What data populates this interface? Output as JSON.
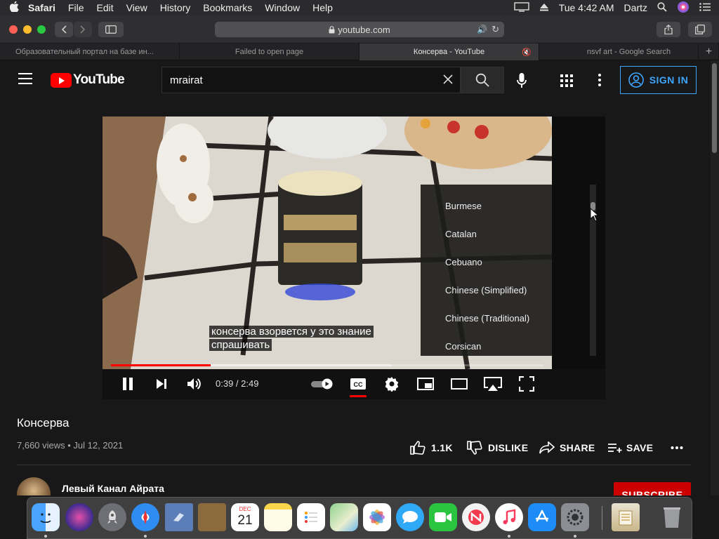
{
  "menubar": {
    "apple": "",
    "app": "Safari",
    "items": [
      "File",
      "Edit",
      "View",
      "History",
      "Bookmarks",
      "Window",
      "Help"
    ],
    "clock": "Tue 4:42 AM",
    "user": "Dartz"
  },
  "toolbar": {
    "url": "youtube.com"
  },
  "tabs": [
    {
      "title": "Образовательный портал на базе ин..."
    },
    {
      "title": "Failed to open page"
    },
    {
      "title": "Консерва - YouTube",
      "mute": "🔇"
    },
    {
      "title": "nsvf art - Google Search"
    }
  ],
  "youtube": {
    "logo_text": "YouTube",
    "search_value": "mrairat",
    "sign_in": "SIGN IN"
  },
  "player": {
    "caption_line1": "консерва взорвется у это знание",
    "caption_line2": "спрашивать",
    "time": "0:39 / 2:49",
    "progress_played": 0.23,
    "progress_loaded": 0.65,
    "languages": [
      "Burmese",
      "Catalan",
      "Cebuano",
      "Chinese (Simplified)",
      "Chinese (Traditional)",
      "Corsican"
    ]
  },
  "video": {
    "title": "Консерва",
    "views_date": "7,660 views • Jul 12, 2021",
    "like_count": "1.1K",
    "dislike": "DISLIKE",
    "share": "SHARE",
    "save": "SAVE"
  },
  "channel": {
    "name": "Левый Канал Айрата",
    "subscribe": "SUBSCRIBE"
  },
  "dock": {
    "calendar_month": "DEC",
    "calendar_day": "21"
  }
}
